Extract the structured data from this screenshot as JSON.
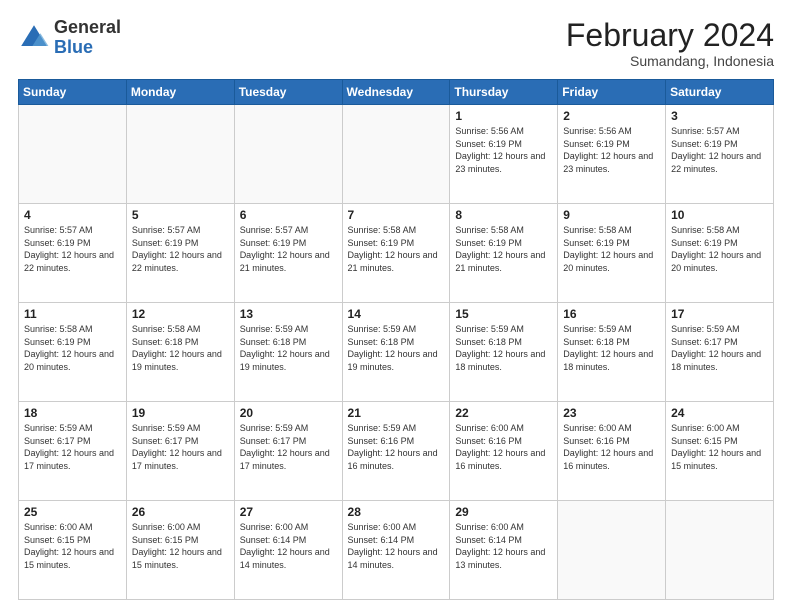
{
  "header": {
    "logo_general": "General",
    "logo_blue": "Blue",
    "month_title": "February 2024",
    "location": "Sumandang, Indonesia"
  },
  "weekdays": [
    "Sunday",
    "Monday",
    "Tuesday",
    "Wednesday",
    "Thursday",
    "Friday",
    "Saturday"
  ],
  "weeks": [
    [
      {
        "day": "",
        "info": ""
      },
      {
        "day": "",
        "info": ""
      },
      {
        "day": "",
        "info": ""
      },
      {
        "day": "",
        "info": ""
      },
      {
        "day": "1",
        "info": "Sunrise: 5:56 AM\nSunset: 6:19 PM\nDaylight: 12 hours\nand 23 minutes."
      },
      {
        "day": "2",
        "info": "Sunrise: 5:56 AM\nSunset: 6:19 PM\nDaylight: 12 hours\nand 23 minutes."
      },
      {
        "day": "3",
        "info": "Sunrise: 5:57 AM\nSunset: 6:19 PM\nDaylight: 12 hours\nand 22 minutes."
      }
    ],
    [
      {
        "day": "4",
        "info": "Sunrise: 5:57 AM\nSunset: 6:19 PM\nDaylight: 12 hours\nand 22 minutes."
      },
      {
        "day": "5",
        "info": "Sunrise: 5:57 AM\nSunset: 6:19 PM\nDaylight: 12 hours\nand 22 minutes."
      },
      {
        "day": "6",
        "info": "Sunrise: 5:57 AM\nSunset: 6:19 PM\nDaylight: 12 hours\nand 21 minutes."
      },
      {
        "day": "7",
        "info": "Sunrise: 5:58 AM\nSunset: 6:19 PM\nDaylight: 12 hours\nand 21 minutes."
      },
      {
        "day": "8",
        "info": "Sunrise: 5:58 AM\nSunset: 6:19 PM\nDaylight: 12 hours\nand 21 minutes."
      },
      {
        "day": "9",
        "info": "Sunrise: 5:58 AM\nSunset: 6:19 PM\nDaylight: 12 hours\nand 20 minutes."
      },
      {
        "day": "10",
        "info": "Sunrise: 5:58 AM\nSunset: 6:19 PM\nDaylight: 12 hours\nand 20 minutes."
      }
    ],
    [
      {
        "day": "11",
        "info": "Sunrise: 5:58 AM\nSunset: 6:19 PM\nDaylight: 12 hours\nand 20 minutes."
      },
      {
        "day": "12",
        "info": "Sunrise: 5:58 AM\nSunset: 6:18 PM\nDaylight: 12 hours\nand 19 minutes."
      },
      {
        "day": "13",
        "info": "Sunrise: 5:59 AM\nSunset: 6:18 PM\nDaylight: 12 hours\nand 19 minutes."
      },
      {
        "day": "14",
        "info": "Sunrise: 5:59 AM\nSunset: 6:18 PM\nDaylight: 12 hours\nand 19 minutes."
      },
      {
        "day": "15",
        "info": "Sunrise: 5:59 AM\nSunset: 6:18 PM\nDaylight: 12 hours\nand 18 minutes."
      },
      {
        "day": "16",
        "info": "Sunrise: 5:59 AM\nSunset: 6:18 PM\nDaylight: 12 hours\nand 18 minutes."
      },
      {
        "day": "17",
        "info": "Sunrise: 5:59 AM\nSunset: 6:17 PM\nDaylight: 12 hours\nand 18 minutes."
      }
    ],
    [
      {
        "day": "18",
        "info": "Sunrise: 5:59 AM\nSunset: 6:17 PM\nDaylight: 12 hours\nand 17 minutes."
      },
      {
        "day": "19",
        "info": "Sunrise: 5:59 AM\nSunset: 6:17 PM\nDaylight: 12 hours\nand 17 minutes."
      },
      {
        "day": "20",
        "info": "Sunrise: 5:59 AM\nSunset: 6:17 PM\nDaylight: 12 hours\nand 17 minutes."
      },
      {
        "day": "21",
        "info": "Sunrise: 5:59 AM\nSunset: 6:16 PM\nDaylight: 12 hours\nand 16 minutes."
      },
      {
        "day": "22",
        "info": "Sunrise: 6:00 AM\nSunset: 6:16 PM\nDaylight: 12 hours\nand 16 minutes."
      },
      {
        "day": "23",
        "info": "Sunrise: 6:00 AM\nSunset: 6:16 PM\nDaylight: 12 hours\nand 16 minutes."
      },
      {
        "day": "24",
        "info": "Sunrise: 6:00 AM\nSunset: 6:15 PM\nDaylight: 12 hours\nand 15 minutes."
      }
    ],
    [
      {
        "day": "25",
        "info": "Sunrise: 6:00 AM\nSunset: 6:15 PM\nDaylight: 12 hours\nand 15 minutes."
      },
      {
        "day": "26",
        "info": "Sunrise: 6:00 AM\nSunset: 6:15 PM\nDaylight: 12 hours\nand 15 minutes."
      },
      {
        "day": "27",
        "info": "Sunrise: 6:00 AM\nSunset: 6:14 PM\nDaylight: 12 hours\nand 14 minutes."
      },
      {
        "day": "28",
        "info": "Sunrise: 6:00 AM\nSunset: 6:14 PM\nDaylight: 12 hours\nand 14 minutes."
      },
      {
        "day": "29",
        "info": "Sunrise: 6:00 AM\nSunset: 6:14 PM\nDaylight: 12 hours\nand 13 minutes."
      },
      {
        "day": "",
        "info": ""
      },
      {
        "day": "",
        "info": ""
      }
    ]
  ]
}
